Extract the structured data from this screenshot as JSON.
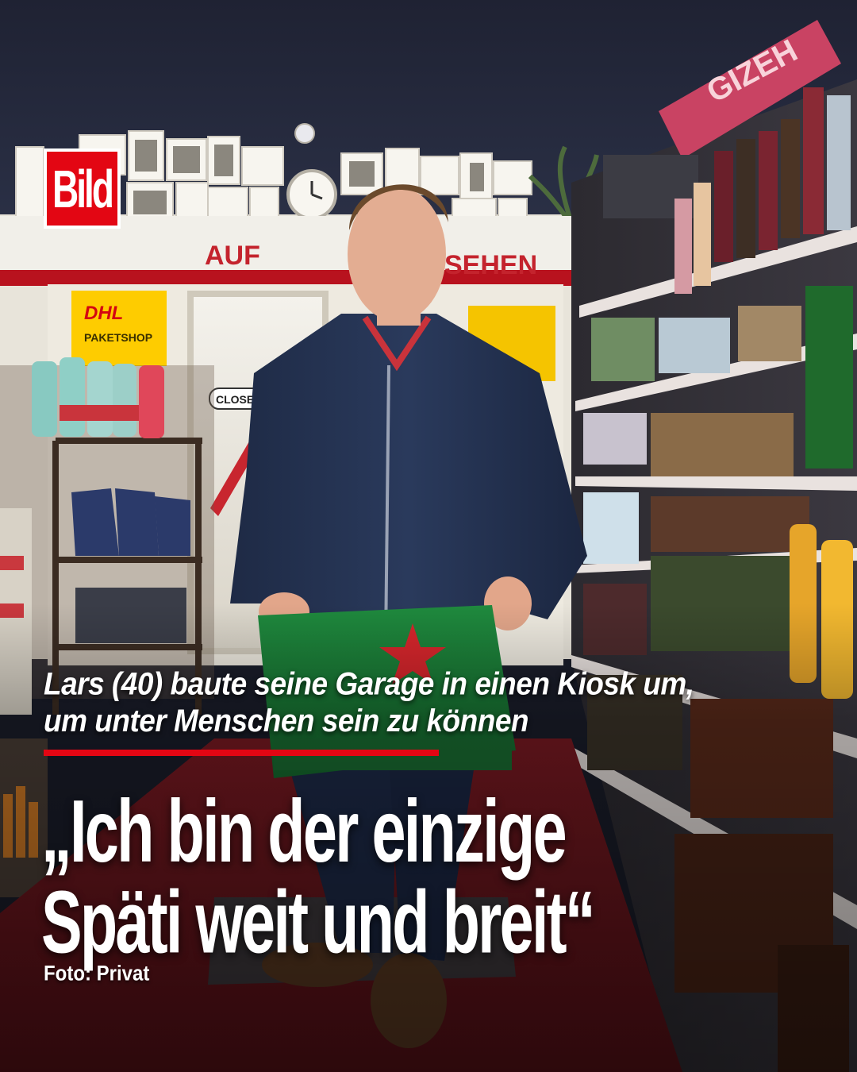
{
  "brand": {
    "logo_text": "Bild",
    "brand_red": "#e30613"
  },
  "photo_signage": {
    "wall_sign_left": "AUF",
    "wall_sign_right": "SEHEN",
    "dhl_logo": "DHL",
    "dhl_label": "PAKETSHOP",
    "door_sign": "CLOSED",
    "banner_text": "GIZEH"
  },
  "kicker": {
    "line1": "Lars (40) baute seine Garage in einen Kiosk um,",
    "line2": "um unter Menschen sein zu können"
  },
  "headline": {
    "line1": "„Ich bin der einzige",
    "line2": "Späti weit und breit“"
  },
  "credit": "Foto: Privat"
}
